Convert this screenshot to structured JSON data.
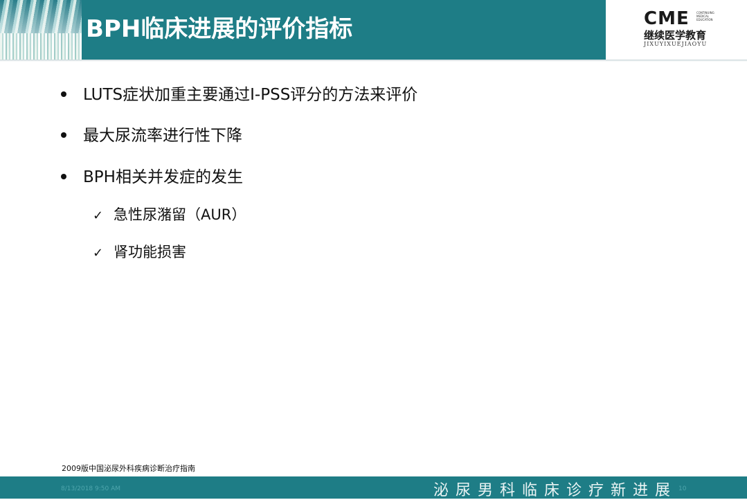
{
  "header": {
    "title": "BPH临床进展的评价指标",
    "logo": {
      "brand": "CME",
      "brand_sub": "CONTINUING MEDICAL EDUCATION",
      "chinese": "继续医学教育",
      "pinyin": "JIXUYIXUEJIAOYU"
    },
    "colors": {
      "band": "#1e7d86",
      "title_text": "#ffffff"
    }
  },
  "content": {
    "bullets": [
      {
        "text": "LUTS症状加重主要通过I-PSS评分的方法来评价"
      },
      {
        "text": "最大尿流率进行性下降"
      },
      {
        "text": "BPH相关并发症的发生"
      }
    ],
    "sub_bullets": [
      {
        "marker": "✓",
        "text": "急性尿潴留（AUR）"
      },
      {
        "marker": "✓",
        "text": "肾功能损害"
      }
    ]
  },
  "source": "2009版中国泌尿外科疾病诊断治疗指南",
  "footer": {
    "date": "8/13/2018 9:50 AM",
    "page": "10",
    "banner": "泌尿男科临床诊疗新进展"
  }
}
